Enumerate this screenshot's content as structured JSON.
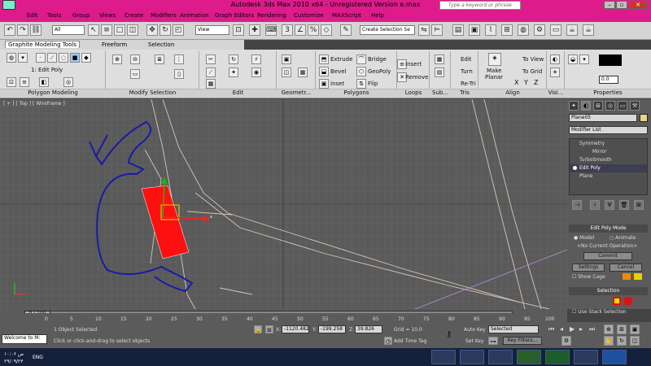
{
  "title": "Autodesk 3ds Max  2010 x64  -  Unregistered Version     e.max",
  "search_placeholder": "Type a keyword or phrase",
  "menu": [
    "Edit",
    "Tools",
    "Group",
    "Views",
    "Create",
    "Modifiers",
    "Animation",
    "Graph Editors",
    "Rendering",
    "Customize",
    "MAXScript",
    "Help"
  ],
  "toolbar": {
    "filter": "All",
    "refcoord": "View",
    "selset": "Create Selection Se"
  },
  "ribbon_tabs": [
    "Graphite Modeling Tools",
    "Freeform",
    "Selection"
  ],
  "ribbon": {
    "edit_poly": "1: Edit Poly",
    "groups": [
      "Polygon Modeling",
      "Modify Selection",
      "Edit",
      "Geometr...",
      "Polygons",
      "Loops",
      "Sub...",
      "Tris",
      "Align",
      "Visi...",
      "Properties"
    ],
    "extrude": "Extrude",
    "bevel": "Bevel",
    "inset": "Inset",
    "bridge": "Bridge",
    "geopoly": "GeoPoly",
    "flip": "Flip",
    "insert": "Insert",
    "remove": "Remove",
    "edit": "Edit",
    "turn": "Turn",
    "retri": "Re-Tri",
    "make_planar": [
      "Make",
      "Planar"
    ],
    "to_view": "To View",
    "to_grid": "To Grid",
    "xyz": [
      "X",
      "Y",
      "Z"
    ],
    "prop_value": "0.0"
  },
  "viewport_label": "[ + ] [ Top ] [ Wireframe ]",
  "cmd": {
    "object_name": "Plane05",
    "modifier_list": "Modifier List",
    "stack": [
      "Symmetry",
      "Mirror",
      "TurboSmooth",
      "Edit Poly",
      "Plane"
    ],
    "editpoly_mode": "Edit Poly Mode",
    "model": "Model",
    "animate": "Animate",
    "no_op": "<No Current Operation>",
    "commit": "Commit",
    "settings": "Settings",
    "cancel": "Cancel",
    "show_cage": "Show Cage",
    "selection": "Selection",
    "use_stack": "Use Stack Selection"
  },
  "timeslider": "0 / 100",
  "ticks": [
    "0",
    "5",
    "10",
    "15",
    "20",
    "25",
    "30",
    "35",
    "40",
    "45",
    "50",
    "55",
    "60",
    "65",
    "70",
    "75",
    "80",
    "85",
    "90",
    "95",
    "100"
  ],
  "status": {
    "welcome": "Welcome to M:",
    "selected": "1 Object Selected",
    "prompt": "Click or click-and-drag to select objects",
    "x_label": "X:",
    "x": "-1120.482",
    "y_label": "Y:",
    "y": "-199.258",
    "z_label": "Z:",
    "z": "39.826",
    "grid": "Grid = 10.0",
    "add_time_tag": "Add Time Tag",
    "auto_key": "Auto Key",
    "set_key": "Set Key",
    "key_sel": "Selected",
    "key_filters": "Key Filters..."
  },
  "taskbar": {
    "lang": "ENG",
    "time": "ص ۱۰:۰۶",
    "date": "۲۹/۰۹/۲۳"
  },
  "colors": {
    "title": "#de1b8b",
    "object": "#ff0000",
    "spline": "#1a1aa8",
    "grid": "#707070"
  }
}
